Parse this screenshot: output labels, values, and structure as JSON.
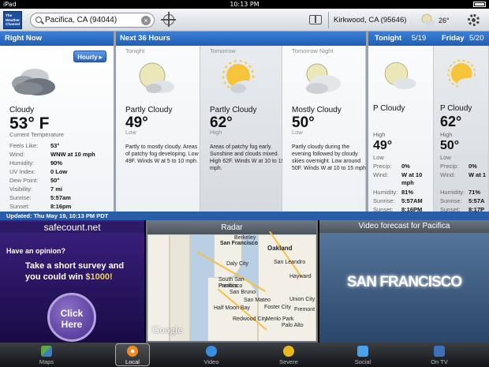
{
  "status": {
    "device": "iPad",
    "time": "10:13 PM"
  },
  "logo": {
    "text": "The Weather Channel"
  },
  "search": {
    "value": "Pacifica, CA (94044)",
    "clear": "×"
  },
  "secondary": {
    "location": "Kirkwood, CA (95646)",
    "temp": "26°"
  },
  "headers": {
    "right_now": "Right Now",
    "next36": "Next 36 Hours",
    "tonight": "Tonight",
    "tonight_date": "5/19",
    "friday": "Friday",
    "friday_date": "5/20"
  },
  "now": {
    "hourly": "Hourly ▸",
    "condition": "Cloudy",
    "temp": "53° F",
    "temp_caption": "Current Temperature",
    "details": [
      {
        "label": "Feels Like:",
        "value": "53°"
      },
      {
        "label": "Wind:",
        "value": "WNW at 10 mph"
      },
      {
        "label": "Humidity:",
        "value": "90%"
      },
      {
        "label": "UV Index:",
        "value": "0 Low"
      },
      {
        "label": "Dew Point:",
        "value": "50°"
      },
      {
        "label": "Visibility:",
        "value": "7 mi"
      },
      {
        "label": "Sunrise:",
        "value": "5:57am"
      },
      {
        "label": "Sunset:",
        "value": "8:16pm"
      }
    ]
  },
  "forecast": [
    {
      "label": "Tonight",
      "condition": "Partly Cloudy",
      "temp": "49°",
      "hl": "Low",
      "desc": "Partly to mostly cloudy. Areas of patchy fog developing. Low 49F. Winds W at 5 to 10 mph.",
      "icon": "partly-cloudy-night-icon"
    },
    {
      "label": "Tomorrow",
      "condition": "Partly Cloudy",
      "temp": "62°",
      "hl": "High",
      "desc": "Areas of patchy fog early. Sunshine and clouds mixed. High 62F. Winds W at 10 to 15 mph.",
      "icon": "partly-cloudy-day-icon"
    },
    {
      "label": "Tomorrow Night",
      "condition": "Mostly Cloudy",
      "temp": "50°",
      "hl": "Low",
      "desc": "Partly cloudy during the evening followed by cloudy skies overnight. Low around 50F. Winds W at 10 to 15 mph.",
      "icon": "mostly-cloudy-night-icon"
    }
  ],
  "days": [
    {
      "condition": "P Cloudy",
      "hl1": "High",
      "t1": "49°",
      "hl2": "Low",
      "t2": "",
      "precip": "0%",
      "wind": "W at 10 mph",
      "humidity": "81%",
      "sunrise": "5:57AM",
      "sunset": "8:16PM",
      "icon": "partly-cloudy-night-icon"
    },
    {
      "condition": "P Cloudy",
      "hl1": "",
      "t1": "62°",
      "hl2": "High",
      "t2": "50°",
      "hl3": "Low",
      "precip": "0%",
      "wind": "W at 1",
      "humidity": "71%",
      "sunrise": "5:57A",
      "sunset": "8:17P",
      "icon": "partly-cloudy-day-icon"
    }
  ],
  "day_labels": {
    "precip": "Precip:",
    "wind": "Wind:",
    "humidity": "Humidity:",
    "sunrise": "Sunrise:",
    "sunset": "Sunset:"
  },
  "updated": "Updated: Thu May 19, 10:13 PM PDT",
  "ad": {
    "brand": "safecount.net",
    "question": "Have an opinion?",
    "offer_pre": "Take a short survey and you could win ",
    "amount": "$1000!",
    "button": "Click Here"
  },
  "radar": {
    "title": "Radar",
    "places": [
      "San Francisco",
      "Oakland",
      "Berkeley",
      "Daly City",
      "San Leandro",
      "Hayward",
      "South San Francisco",
      "San Bruno",
      "Pacifica",
      "San Mateo",
      "Foster City",
      "Union City",
      "Fremont",
      "Redwood City",
      "Palo Alto",
      "Menlo Park",
      "Half Moon Bay"
    ],
    "logo": "Google"
  },
  "video": {
    "title": "Video forecast for Pacifica",
    "caption": "SAN FRANCISCO"
  },
  "tabs": [
    {
      "label": "Maps",
      "icon": "maps-icon"
    },
    {
      "label": "Local",
      "icon": "local-icon"
    },
    {
      "label": "Video",
      "icon": "video-icon"
    },
    {
      "label": "Severe",
      "icon": "severe-icon"
    },
    {
      "label": "Social",
      "icon": "social-icon"
    },
    {
      "label": "On TV",
      "icon": "on-tv-icon"
    }
  ],
  "colors": {
    "header_blue": "#2d6cc4",
    "updated_bar": "#2a5da8",
    "ad_purple": "#3c2180",
    "amount": "#f5d54a"
  }
}
